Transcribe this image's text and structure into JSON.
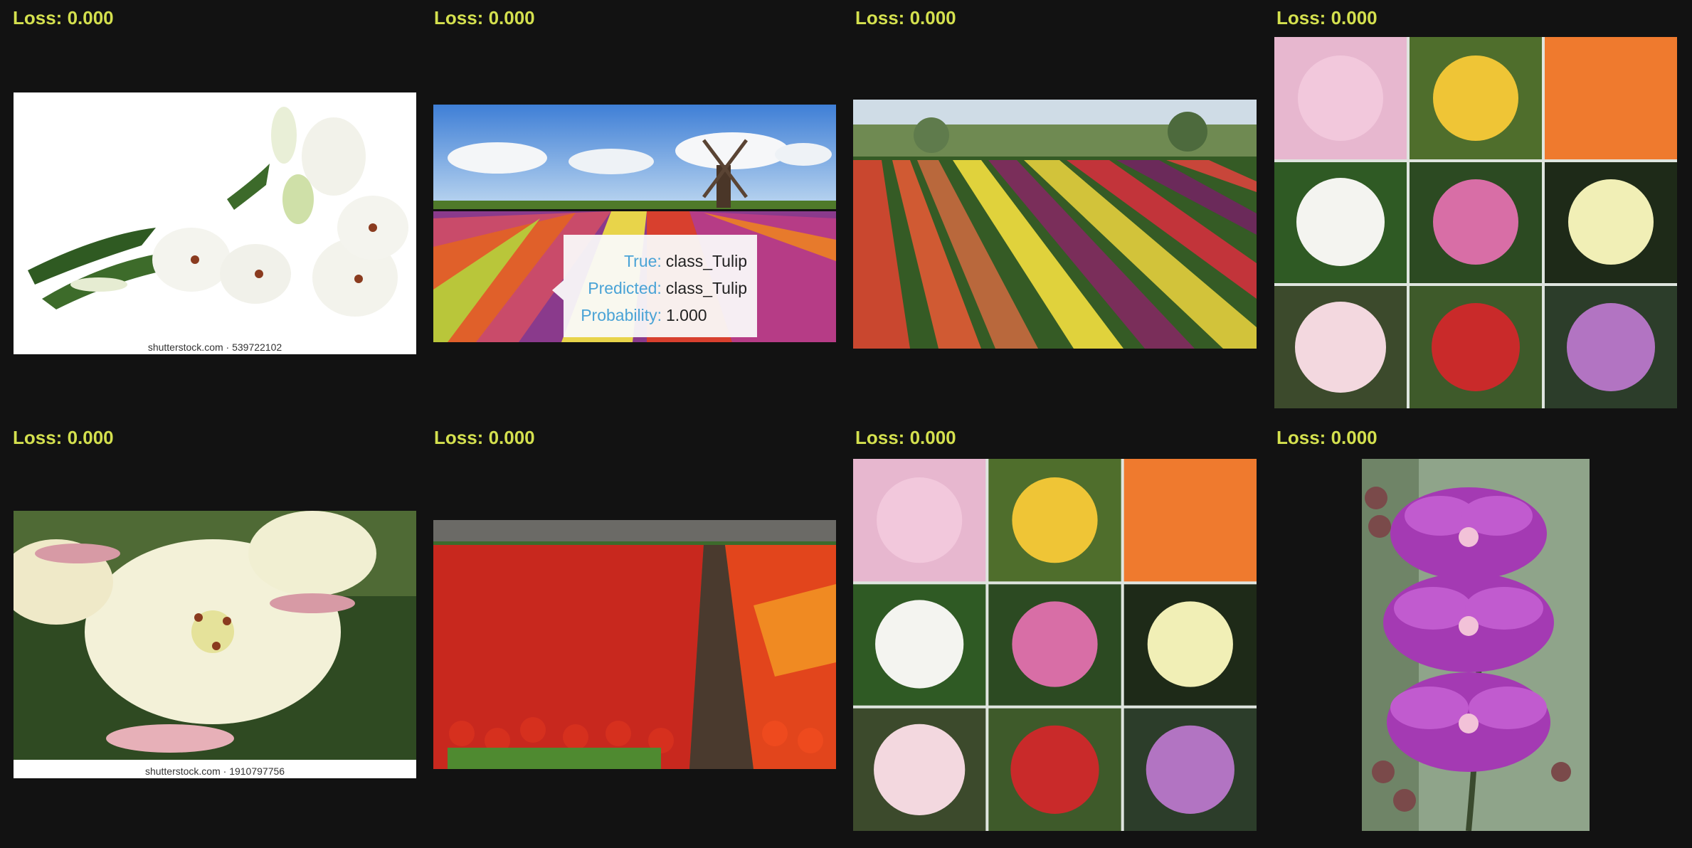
{
  "grid": {
    "cells": [
      {
        "loss": "Loss: 0.000",
        "image": "white lily bouquet",
        "watermark": "shutterstock.com · 539722102"
      },
      {
        "loss": "Loss: 0.000",
        "image": "tulip field with windmill",
        "watermark": ""
      },
      {
        "loss": "Loss: 0.000",
        "image": "tulip field rows",
        "watermark": ""
      },
      {
        "loss": "Loss: 0.000",
        "image": "lily collage 3x3",
        "watermark": ""
      },
      {
        "loss": "Loss: 0.000",
        "image": "white lily close-up",
        "watermark": "shutterstock.com · 1910797756"
      },
      {
        "loss": "Loss: 0.000",
        "image": "red tulip field",
        "watermark": ""
      },
      {
        "loss": "Loss: 0.000",
        "image": "lily collage 3x3",
        "watermark": ""
      },
      {
        "loss": "Loss: 0.000",
        "image": "purple orchid",
        "watermark": ""
      }
    ]
  },
  "tooltip": {
    "true_label": "True:",
    "true_value": "class_Tulip",
    "pred_label": "Predicted:",
    "pred_value": "class_Tulip",
    "prob_label": "Probability:",
    "prob_value": "1.000"
  },
  "colors": {
    "background": "#121212",
    "loss_text": "#d4e04e",
    "tooltip_key": "#4aa3d6"
  }
}
